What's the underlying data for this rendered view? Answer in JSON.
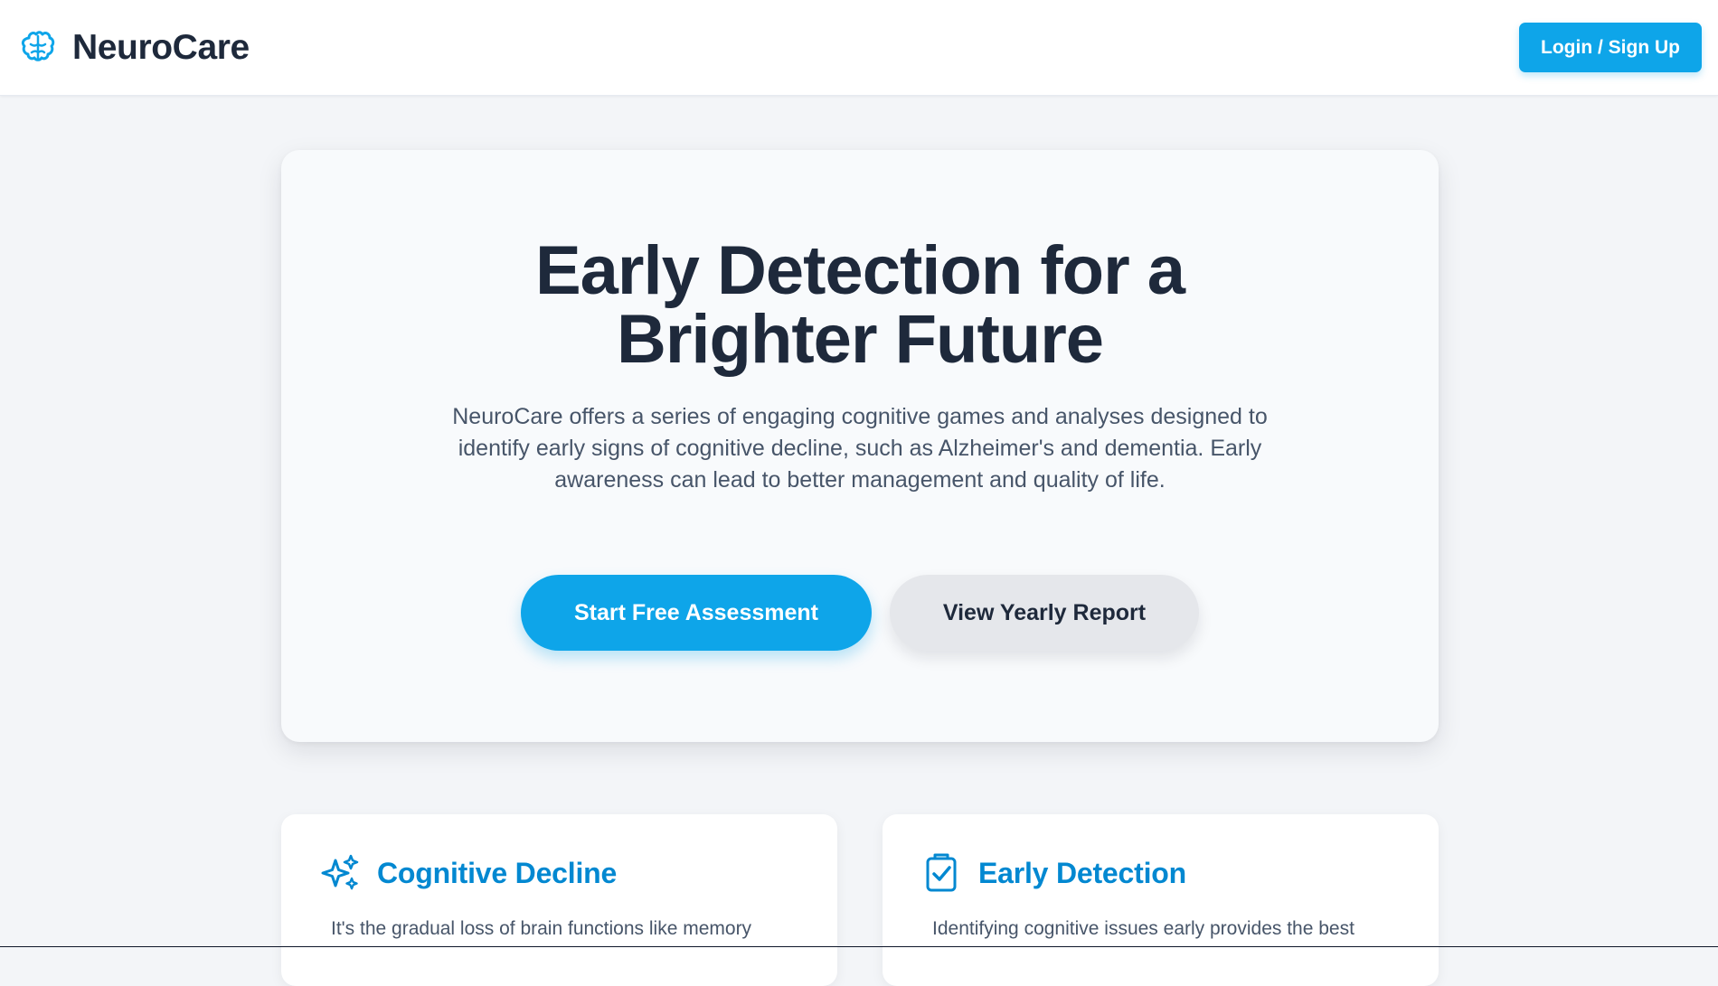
{
  "header": {
    "brand_name": "NeuroCare",
    "brand_icon": "brain-icon",
    "login_label": "Login / Sign Up"
  },
  "hero": {
    "title_line_1": "Early Detection for a",
    "title_line_2": "Brighter Future",
    "description": "NeuroCare offers a series of engaging cognitive games and analyses designed to identify early signs of cognitive decline, such as Alzheimer's and dementia. Early awareness can lead to better management and quality of life.",
    "primary_cta": "Start Free Assessment",
    "secondary_cta": "View Yearly Report"
  },
  "features": [
    {
      "icon": "sparkles-icon",
      "title": "Cognitive Decline",
      "text": "It's the gradual loss of brain functions like memory"
    },
    {
      "icon": "clipboard-check-icon",
      "title": "Early Detection",
      "text": "Identifying cognitive issues early provides the best"
    }
  ],
  "colors": {
    "accent": "#0ea5e9",
    "heading": "#1e293b",
    "feature_title": "#0288d1",
    "page_background": "#f3f5f8",
    "card_background": "#f8fafc"
  }
}
